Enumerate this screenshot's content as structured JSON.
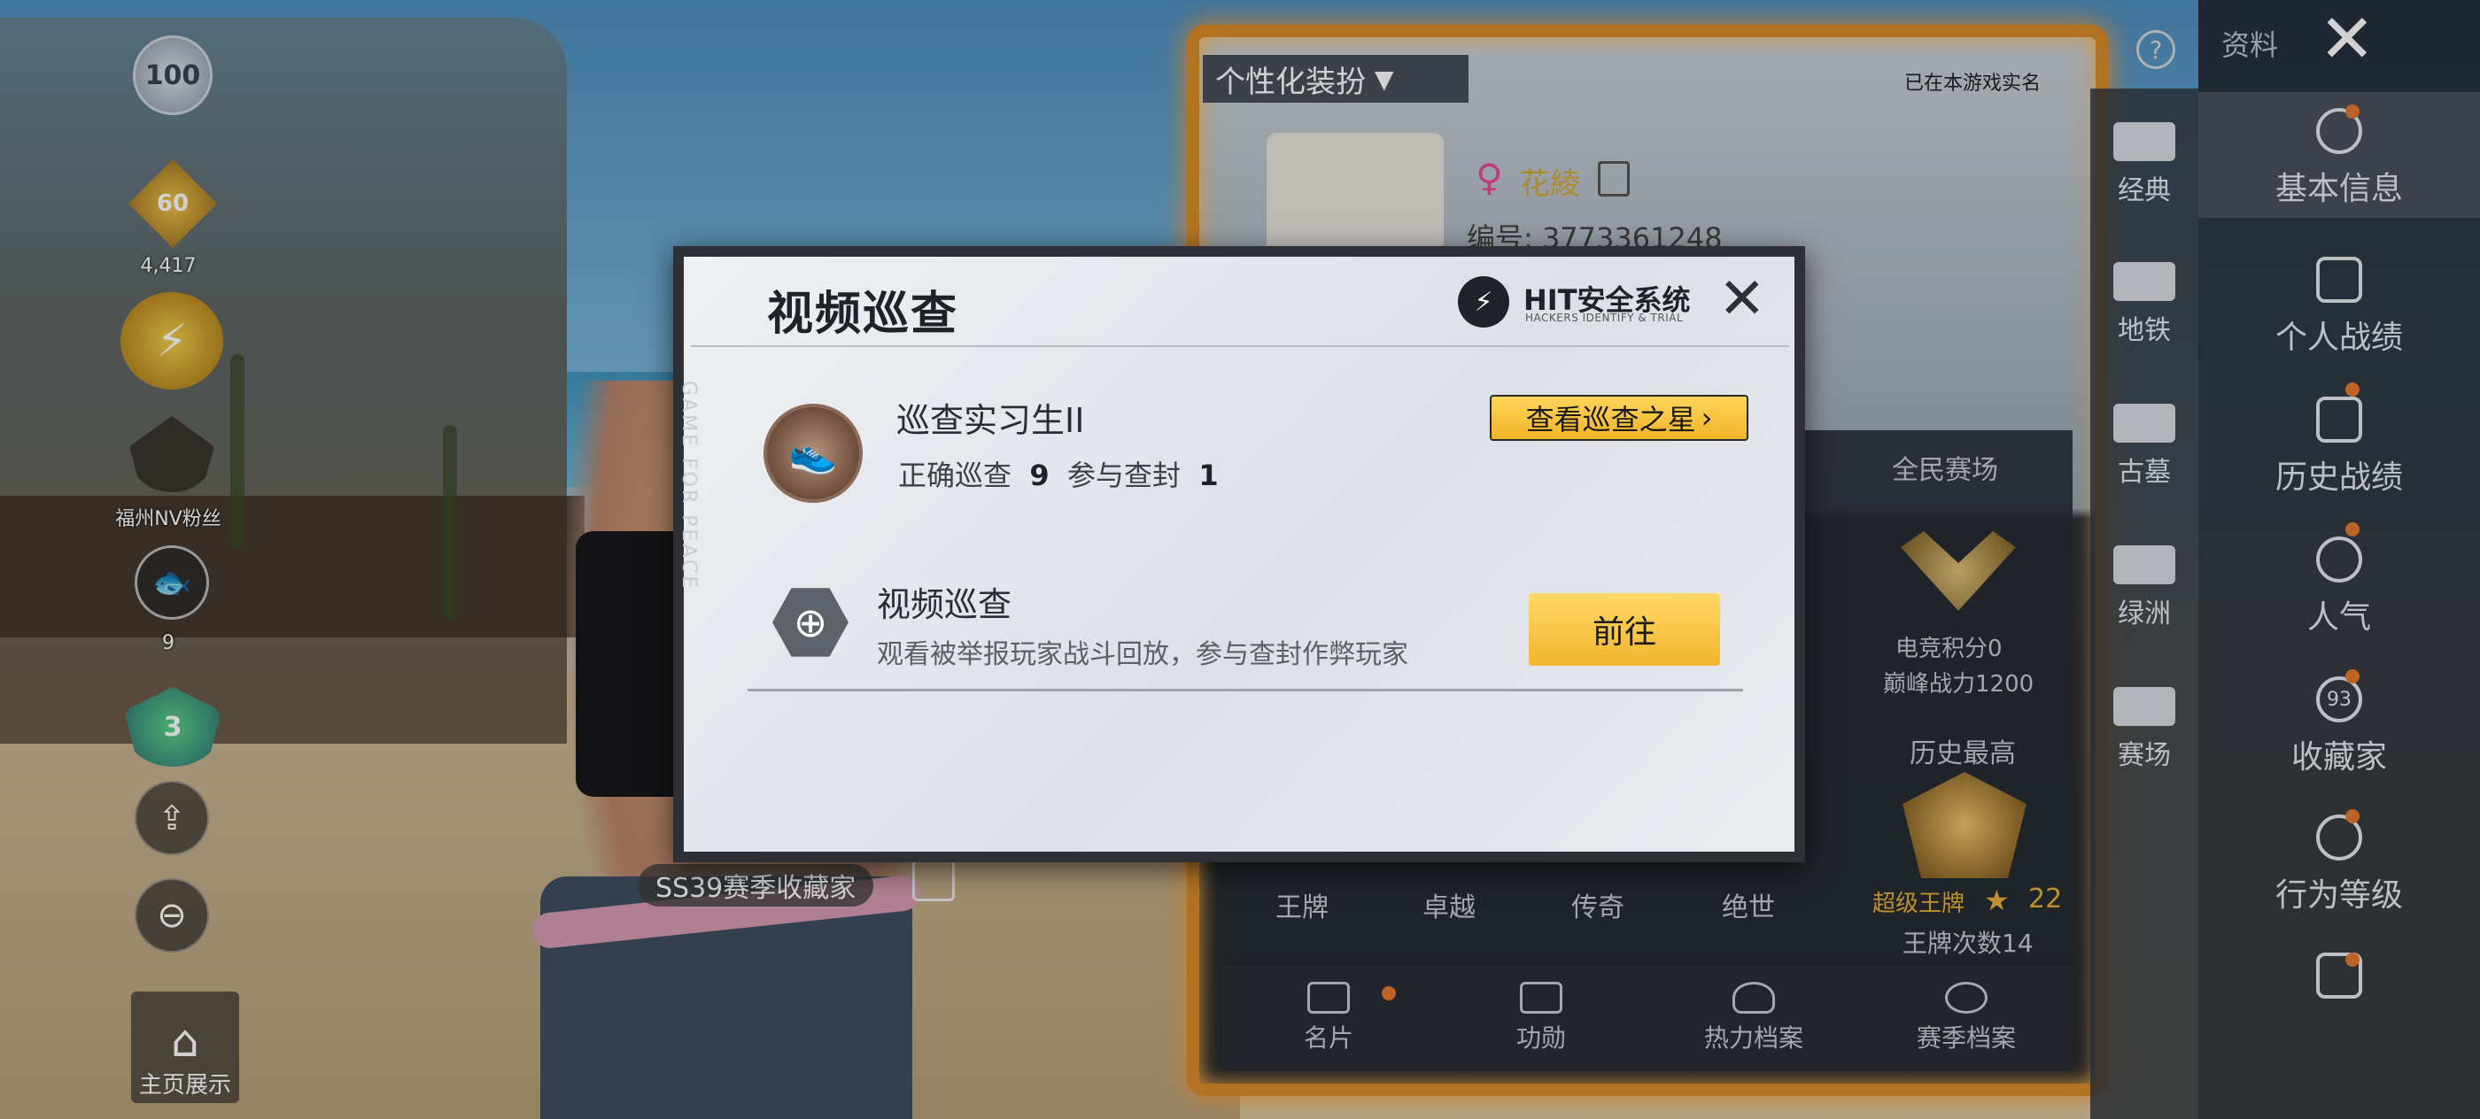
{
  "left_column": {
    "level_badge": "100",
    "rank_badge": "60",
    "rank_value": "4,417",
    "fan_label": "福州NV粉丝",
    "fish_count": "9",
    "shield_level": "3",
    "home_display": "主页展示"
  },
  "profile": {
    "customize_tab": "个性化装扮",
    "verified": "已在本游戏实名",
    "nickname": "花綾",
    "id_text": "编号: 3773361248",
    "season_badge": "SS39赛季收藏家"
  },
  "stats": {
    "mode_title": "全民赛场",
    "esports_points": "电竞积分0",
    "peak_power": "巅峰战力1200",
    "history_best": "历史最高",
    "super_ace": "超级王牌",
    "super_ace_stars": "22",
    "ace_count": "王牌次数14",
    "tiers": [
      "王牌",
      "卓越",
      "传奇",
      "绝世"
    ]
  },
  "bottom_tabs": [
    "名片",
    "功勋",
    "热力档案",
    "赛季档案"
  ],
  "map_strip": [
    "经典",
    "地铁",
    "古墓",
    "绿洲",
    "赛场"
  ],
  "right_menu": {
    "header": "资料",
    "items": [
      "基本信息",
      "个人战绩",
      "历史战绩",
      "人气",
      "收藏家",
      "行为等级"
    ],
    "collector_level": "93"
  },
  "modal": {
    "title": "视频巡查",
    "hit_title": "HIT安全系统",
    "hit_sub": "HACKERS IDENTIFY & TRIAL",
    "rank_name": "巡查实习生II",
    "correct_label": "正确巡查",
    "correct_value": "9",
    "ban_label": "参与查封",
    "ban_value": "1",
    "star_button": "查看巡查之星",
    "patrol_name": "视频巡查",
    "patrol_desc": "观看被举报玩家战斗回放，参与查封作弊玩家",
    "go_button": "前往",
    "watermark": "GAME FOR PEACE"
  },
  "colors": {
    "accent_gold": "#f2b52d",
    "frame_orange": "#d88d29",
    "dot_orange": "#e8782e",
    "female_pink": "#e44c8e"
  }
}
